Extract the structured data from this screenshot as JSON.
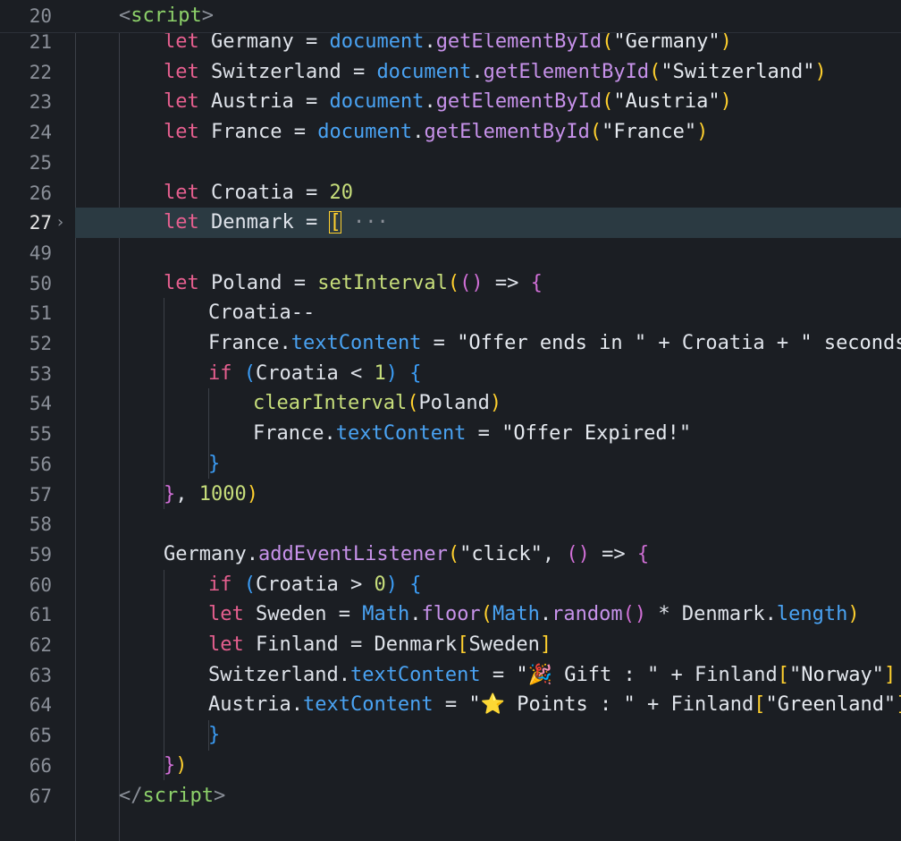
{
  "colors": {
    "background": "#1b1e23",
    "active_line": "#2b3a42",
    "keyword": "#e65f8f",
    "string": "#e6eaf0",
    "function": "#c7de7b",
    "method": "#c792ea",
    "property": "#4aa3f3"
  },
  "sticky_header": {
    "number": "20",
    "tokens": [
      [
        "tb",
        "<"
      ],
      [
        "tg",
        "script"
      ],
      [
        "tb",
        ">"
      ]
    ]
  },
  "lines": [
    {
      "number": "21",
      "indent": 3,
      "tokens": [
        [
          "kw",
          "let"
        ],
        [
          "id",
          " Germany "
        ],
        [
          "op",
          "="
        ],
        [
          "id",
          " "
        ],
        [
          "ob",
          "document"
        ],
        [
          "pu",
          "."
        ],
        [
          "fn2",
          "getElementById"
        ],
        [
          "b1",
          "("
        ],
        [
          "st",
          "\"Germany\""
        ],
        [
          "b1",
          ")"
        ]
      ]
    },
    {
      "number": "22",
      "indent": 3,
      "tokens": [
        [
          "kw",
          "let"
        ],
        [
          "id",
          " Switzerland "
        ],
        [
          "op",
          "="
        ],
        [
          "id",
          " "
        ],
        [
          "ob",
          "document"
        ],
        [
          "pu",
          "."
        ],
        [
          "fn2",
          "getElementById"
        ],
        [
          "b1",
          "("
        ],
        [
          "st",
          "\"Switzerland\""
        ],
        [
          "b1",
          ")"
        ]
      ]
    },
    {
      "number": "23",
      "indent": 3,
      "tokens": [
        [
          "kw",
          "let"
        ],
        [
          "id",
          " Austria "
        ],
        [
          "op",
          "="
        ],
        [
          "id",
          " "
        ],
        [
          "ob",
          "document"
        ],
        [
          "pu",
          "."
        ],
        [
          "fn2",
          "getElementById"
        ],
        [
          "b1",
          "("
        ],
        [
          "st",
          "\"Austria\""
        ],
        [
          "b1",
          ")"
        ]
      ]
    },
    {
      "number": "24",
      "indent": 3,
      "tokens": [
        [
          "kw",
          "let"
        ],
        [
          "id",
          " France "
        ],
        [
          "op",
          "="
        ],
        [
          "id",
          " "
        ],
        [
          "ob",
          "document"
        ],
        [
          "pu",
          "."
        ],
        [
          "fn2",
          "getElementById"
        ],
        [
          "b1",
          "("
        ],
        [
          "st",
          "\"France\""
        ],
        [
          "b1",
          ")"
        ]
      ]
    },
    {
      "number": "25",
      "indent": 0,
      "tokens": []
    },
    {
      "number": "26",
      "indent": 3,
      "tokens": [
        [
          "kw",
          "let"
        ],
        [
          "id",
          " Croatia "
        ],
        [
          "op",
          "="
        ],
        [
          "id",
          " "
        ],
        [
          "nu",
          "20"
        ]
      ]
    },
    {
      "number": "27",
      "indent": 3,
      "active": true,
      "folded": true,
      "tokens": [
        [
          "kw",
          "let"
        ],
        [
          "id",
          " Denmark "
        ],
        [
          "op",
          "="
        ],
        [
          "id",
          " "
        ],
        [
          "b1 bx",
          "["
        ],
        [
          "dots",
          " ···"
        ]
      ]
    },
    {
      "number": "49",
      "indent": 0,
      "tokens": []
    },
    {
      "number": "50",
      "indent": 3,
      "tokens": [
        [
          "kw",
          "let"
        ],
        [
          "id",
          " Poland "
        ],
        [
          "op",
          "="
        ],
        [
          "id",
          " "
        ],
        [
          "fn",
          "setInterval"
        ],
        [
          "b1",
          "("
        ],
        [
          "b2",
          "()"
        ],
        [
          "op",
          " => "
        ],
        [
          "b2",
          "{"
        ]
      ]
    },
    {
      "number": "51",
      "indent": 4,
      "tokens": [
        [
          "id",
          "Croatia--"
        ]
      ]
    },
    {
      "number": "52",
      "indent": 4,
      "tokens": [
        [
          "id",
          "France"
        ],
        [
          "pu",
          "."
        ],
        [
          "pr",
          "textContent"
        ],
        [
          "op",
          " = "
        ],
        [
          "st",
          "\"Offer ends in \""
        ],
        [
          "op",
          " + "
        ],
        [
          "id",
          "Croatia"
        ],
        [
          "op",
          " + "
        ],
        [
          "st",
          "\" seconds\""
        ]
      ]
    },
    {
      "number": "53",
      "indent": 4,
      "tokens": [
        [
          "kw",
          "if"
        ],
        [
          "id",
          " "
        ],
        [
          "b3",
          "("
        ],
        [
          "id",
          "Croatia "
        ],
        [
          "op",
          "<"
        ],
        [
          "id",
          " "
        ],
        [
          "nu",
          "1"
        ],
        [
          "b3",
          ")"
        ],
        [
          "id",
          " "
        ],
        [
          "b3",
          "{"
        ]
      ]
    },
    {
      "number": "54",
      "indent": 5,
      "tokens": [
        [
          "fn",
          "clearInterval"
        ],
        [
          "b1",
          "("
        ],
        [
          "id",
          "Poland"
        ],
        [
          "b1",
          ")"
        ]
      ]
    },
    {
      "number": "55",
      "indent": 5,
      "tokens": [
        [
          "id",
          "France"
        ],
        [
          "pu",
          "."
        ],
        [
          "pr",
          "textContent"
        ],
        [
          "op",
          " = "
        ],
        [
          "st",
          "\"Offer Expired!\""
        ]
      ]
    },
    {
      "number": "56",
      "indent": 4,
      "tokens": [
        [
          "b3",
          "}"
        ]
      ]
    },
    {
      "number": "57",
      "indent": 3,
      "tokens": [
        [
          "b2",
          "}"
        ],
        [
          "pu",
          ", "
        ],
        [
          "nu",
          "1000"
        ],
        [
          "b1",
          ")"
        ]
      ]
    },
    {
      "number": "58",
      "indent": 0,
      "tokens": []
    },
    {
      "number": "59",
      "indent": 3,
      "tokens": [
        [
          "id",
          "Germany"
        ],
        [
          "pu",
          "."
        ],
        [
          "fn2",
          "addEventListener"
        ],
        [
          "b1",
          "("
        ],
        [
          "st",
          "\"click\""
        ],
        [
          "pu",
          ", "
        ],
        [
          "b2",
          "()"
        ],
        [
          "op",
          " => "
        ],
        [
          "b2",
          "{"
        ]
      ]
    },
    {
      "number": "60",
      "indent": 4,
      "tokens": [
        [
          "kw",
          "if"
        ],
        [
          "id",
          " "
        ],
        [
          "b3",
          "("
        ],
        [
          "id",
          "Croatia "
        ],
        [
          "op",
          ">"
        ],
        [
          "id",
          " "
        ],
        [
          "nu",
          "0"
        ],
        [
          "b3",
          ")"
        ],
        [
          "id",
          " "
        ],
        [
          "b3",
          "{"
        ]
      ]
    },
    {
      "number": "61",
      "indent": 4,
      "tokens": [
        [
          "kw",
          "let"
        ],
        [
          "id",
          " Sweden "
        ],
        [
          "op",
          "="
        ],
        [
          "id",
          " "
        ],
        [
          "ob",
          "Math"
        ],
        [
          "pu",
          "."
        ],
        [
          "fn2",
          "floor"
        ],
        [
          "b1",
          "("
        ],
        [
          "ob",
          "Math"
        ],
        [
          "pu",
          "."
        ],
        [
          "fn2",
          "random"
        ],
        [
          "b2",
          "()"
        ],
        [
          "op",
          " * "
        ],
        [
          "id",
          "Denmark"
        ],
        [
          "pu",
          "."
        ],
        [
          "pr",
          "length"
        ],
        [
          "b1",
          ")"
        ]
      ]
    },
    {
      "number": "62",
      "indent": 4,
      "tokens": [
        [
          "kw",
          "let"
        ],
        [
          "id",
          " Finland "
        ],
        [
          "op",
          "="
        ],
        [
          "id",
          " Denmark"
        ],
        [
          "b1",
          "["
        ],
        [
          "id",
          "Sweden"
        ],
        [
          "b1",
          "]"
        ]
      ]
    },
    {
      "number": "63",
      "indent": 4,
      "tokens": [
        [
          "id",
          "Switzerland"
        ],
        [
          "pu",
          "."
        ],
        [
          "pr",
          "textContent"
        ],
        [
          "op",
          " = "
        ],
        [
          "st",
          "\"🎉 Gift : \""
        ],
        [
          "op",
          " + "
        ],
        [
          "id",
          "Finland"
        ],
        [
          "b1",
          "["
        ],
        [
          "st",
          "\"Norway\""
        ],
        [
          "b1",
          "]"
        ]
      ]
    },
    {
      "number": "64",
      "indent": 4,
      "tokens": [
        [
          "id",
          "Austria"
        ],
        [
          "pu",
          "."
        ],
        [
          "pr",
          "textContent"
        ],
        [
          "op",
          " = "
        ],
        [
          "st",
          "\"⭐ Points : \""
        ],
        [
          "op",
          " + "
        ],
        [
          "id",
          "Finland"
        ],
        [
          "b1",
          "["
        ],
        [
          "st",
          "\"Greenland\""
        ],
        [
          "b1",
          "]"
        ]
      ]
    },
    {
      "number": "65",
      "indent": 4,
      "tokens": [
        [
          "b3",
          "}"
        ]
      ]
    },
    {
      "number": "66",
      "indent": 3,
      "tokens": [
        [
          "b2",
          "}"
        ],
        [
          "b1",
          ")"
        ]
      ]
    },
    {
      "number": "67",
      "indent": 2,
      "tokens": [
        [
          "tb",
          "</"
        ],
        [
          "tg",
          "script"
        ],
        [
          "tb",
          ">"
        ]
      ]
    }
  ]
}
